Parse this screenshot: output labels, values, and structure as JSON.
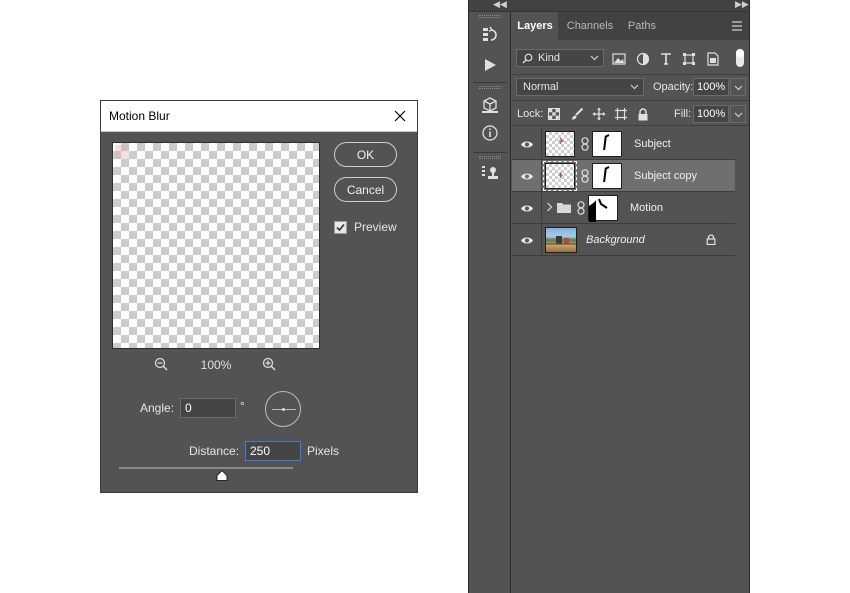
{
  "dialog": {
    "title": "Motion Blur",
    "ok_label": "OK",
    "cancel_label": "Cancel",
    "preview_label": "Preview",
    "preview_checked": true,
    "zoom_percent": "100%",
    "angle_label": "Angle:",
    "angle_value": "0",
    "degree_symbol": "°",
    "distance_label": "Distance:",
    "distance_value": "250",
    "distance_unit": "Pixels",
    "distance_slider_fraction": 0.59
  },
  "panel": {
    "tabs": [
      {
        "label": "Layers",
        "active": true
      },
      {
        "label": "Channels",
        "active": false
      },
      {
        "label": "Paths",
        "active": false
      }
    ],
    "filter_kind": "Kind",
    "blend_mode": "Normal",
    "opacity_label": "Opacity:",
    "opacity_value": "100%",
    "lock_label": "Lock:",
    "fill_label": "Fill:",
    "fill_value": "100%",
    "layers": [
      {
        "name": "Subject",
        "selected": false,
        "has_mask": true,
        "visible": true
      },
      {
        "name": "Subject copy",
        "selected": true,
        "has_mask": true,
        "visible": true
      },
      {
        "name": "Motion",
        "selected": false,
        "is_group": true,
        "has_mask": true,
        "visible": true
      },
      {
        "name": "Background",
        "selected": false,
        "locked": true,
        "visible": true
      }
    ]
  },
  "colors": {
    "panel_bg": "#535353",
    "selected_row": "#6f6f6f",
    "focus_border": "#3b7ddd"
  }
}
